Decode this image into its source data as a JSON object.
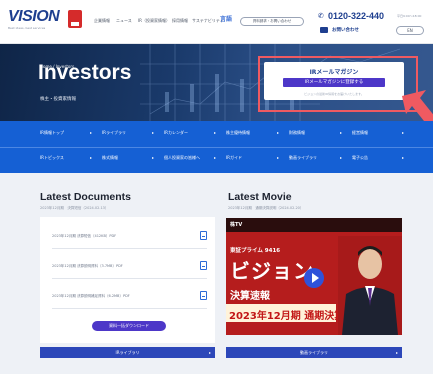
{
  "header": {
    "logo": "VISION",
    "logo_sub": "Best ideas, best services",
    "nav_items": [
      "企業情報",
      "ニュース",
      "IR（投資家情報）",
      "採用情報",
      "サステナビリティ"
    ],
    "lang_label": "言語",
    "pill_label": "資料請求・お問い合わせ",
    "phone": "0120-322-440",
    "phone_hours": "平日9:00〜18:00",
    "contact_label": "お問い合わせ",
    "en_label": "EN"
  },
  "hero": {
    "breadcrumb": "Home / Investors",
    "title": "Investors",
    "subtitle": "株主・投資家情報",
    "promo_title": "IRメールマガジン",
    "promo_button": "IRメールマガジンに登録する",
    "promo_note": "ビジョンの最新IR情報をお届けいたします。"
  },
  "nav": {
    "row1": [
      "IR情報トップ",
      "IRライブラリ",
      "IRカレンダー",
      "株主優待情報",
      "財務情報",
      "経営情報"
    ],
    "row2": [
      "IRトピックス",
      "株式情報",
      "個人投資家の皆様へ",
      "IRガイド",
      "動画ライブラリ",
      "電子公告"
    ]
  },
  "documents": {
    "title": "Latest Documents",
    "date": "2023年12月期　決算短信（2024.02.13）",
    "items": [
      "2023年12月期 決算短信（412KB）PDF",
      "2023年12月期 決算説明資料（3.7MB）PDF",
      "2023年12月期 決算説明補足資料（6.2MB）PDF"
    ],
    "download_button": "資料一括ダウンロード",
    "library_button": "IRライブラリ"
  },
  "movie": {
    "title": "Latest Movie",
    "date": "2023年12月期　通期決算説明（2024.02.20）",
    "channel": "株TV",
    "thumb_line1": "東証プライム 9416",
    "thumb_line2": "ビジョン",
    "thumb_line3": "決算速報",
    "thumb_line4": "2023年12月期 通期決算",
    "library_button": "動画ライブラリ"
  },
  "colors": {
    "nav_blue": "#1560d4",
    "purple_button": "#4d37c8",
    "library_button": "#2c47b9",
    "highlight_red": "#ef5a61"
  }
}
